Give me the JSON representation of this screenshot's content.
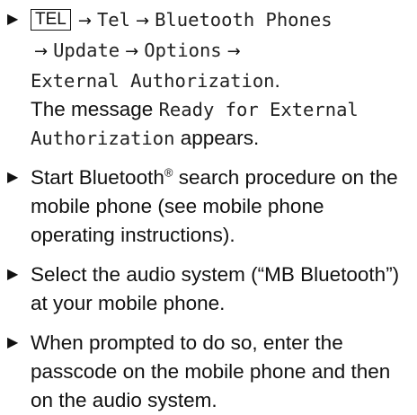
{
  "steps": [
    {
      "key_label": "TEL",
      "menu_path": [
        "Tel",
        "Bluetooth Phones",
        "Update",
        "Options",
        "External Authorization"
      ],
      "path_end": ".",
      "message_prefix": "The message",
      "message_display": "Ready for External Authorization",
      "message_suffix": "appears."
    },
    {
      "text_pre": "Start Bluetooth",
      "text_sup": "®",
      "text_post": " search procedure on the mobile phone (see mobile phone operating instructions)."
    },
    {
      "text": "Select the audio system (“MB Bluetooth”) at your mobile phone."
    },
    {
      "text": "When prompted to do so, enter the passcode on the mobile phone and then on the audio system."
    }
  ],
  "bullet_glyph": "▶",
  "arrow_glyph": "→"
}
